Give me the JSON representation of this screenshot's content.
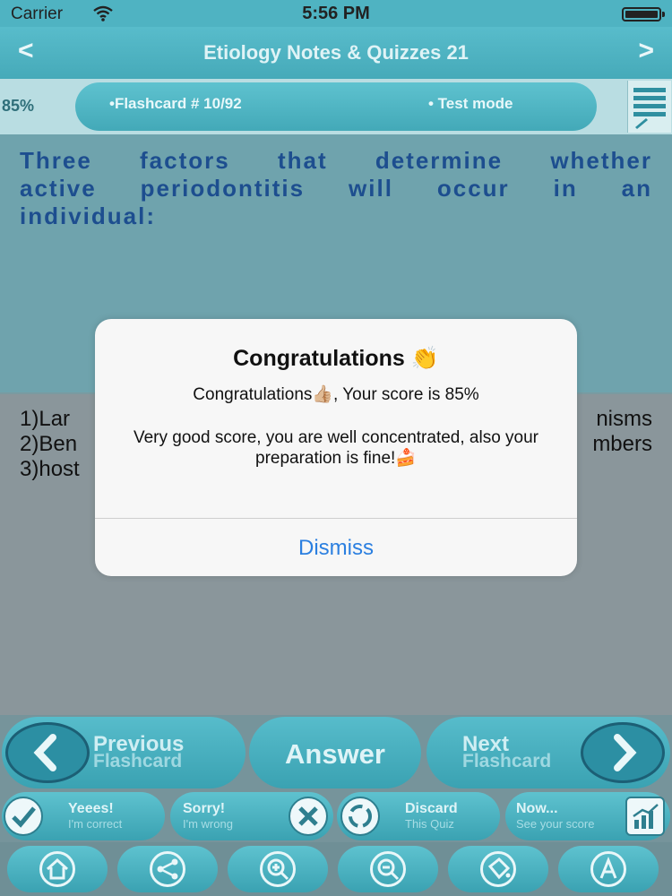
{
  "status_bar": {
    "carrier": "Carrier",
    "time": "5:56 PM"
  },
  "nav": {
    "title": "Etiology Notes & Quizzes 21",
    "back": "<",
    "forward": ">"
  },
  "info": {
    "score": "85%",
    "flashcard": "•Flashcard #  10/92",
    "mode": "• Test mode"
  },
  "question": "Three factors that determine whether active periodontitis will occur in an individual:",
  "answers": {
    "left": [
      "1)Lar",
      "2)Ben",
      "3)host"
    ],
    "right": [
      "nisms",
      "mbers"
    ]
  },
  "controls": {
    "previous": {
      "title": "Previous",
      "sub": "Flashcard"
    },
    "answer": "Answer",
    "next": {
      "title": "Next",
      "sub": "Flashcard"
    },
    "yes": {
      "title": "Yeees!",
      "sub": "I'm correct"
    },
    "sorry": {
      "title": "Sorry!",
      "sub": "I'm wrong"
    },
    "discard": {
      "title": "Discard",
      "sub": "This Quiz"
    },
    "now": {
      "title": "Now...",
      "sub": "See your score"
    }
  },
  "toolbar": [
    "home-icon",
    "share-icon",
    "zoom-in-icon",
    "zoom-out-icon",
    "bucket-icon",
    "font-icon"
  ],
  "modal": {
    "title": "Congratulations 👏",
    "line1": "Congratulations👍🏼, Your score is 85%",
    "body": "Very good score, you are well concentrated, also your preparation is fine!🍰",
    "dismiss": "Dismiss"
  },
  "colors": {
    "accent": "#4fb3c2",
    "question_text": "#1d4e8f",
    "dismiss": "#2b7fe0"
  }
}
